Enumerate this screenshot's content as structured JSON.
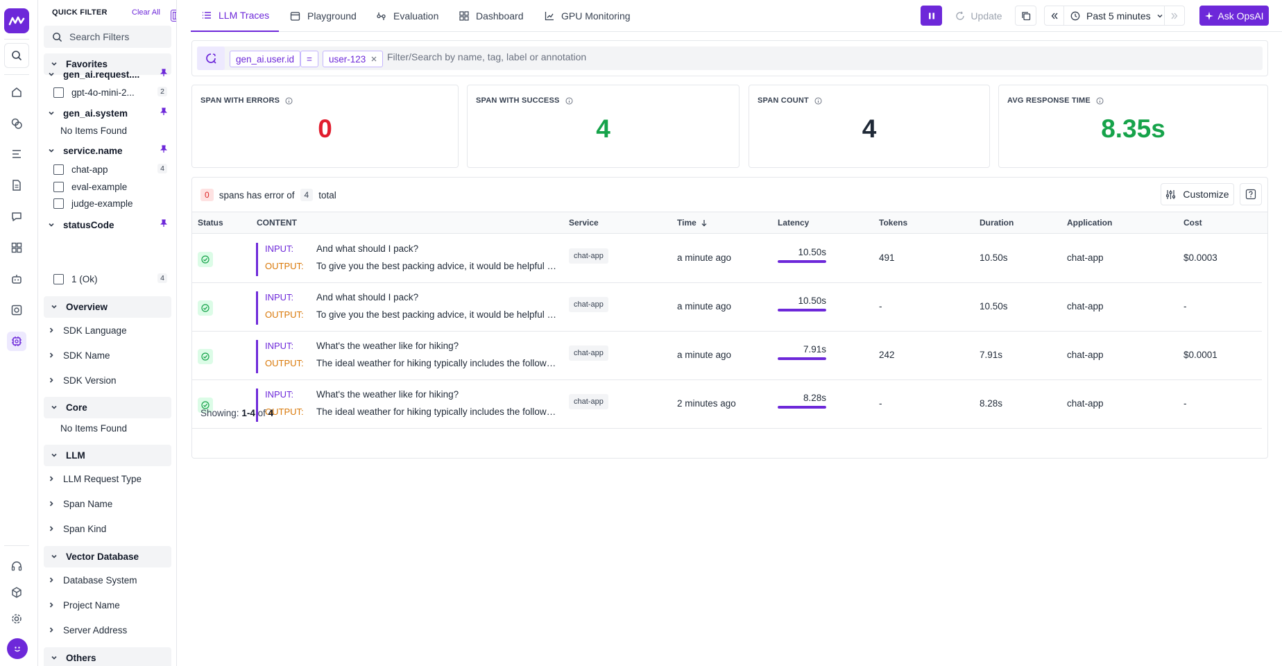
{
  "sidebar": {
    "title": "QUICK FILTER",
    "clear_all": "Clear All",
    "search_placeholder": "Search Filters",
    "favorites": "Favorites",
    "fav_groups": [
      {
        "label": "gen_ai.request....",
        "items": [
          {
            "label": "gpt-4o-mini-2...",
            "count": "2"
          }
        ]
      },
      {
        "label": "gen_ai.system",
        "empty": "No Items Found"
      },
      {
        "label": "service.name",
        "items": [
          {
            "label": "chat-app",
            "count": "4"
          },
          {
            "label": "eval-example"
          },
          {
            "label": "judge-example"
          }
        ]
      },
      {
        "label": "statusCode",
        "items": [
          {
            "label": "1 (Ok)",
            "count": "4"
          }
        ]
      }
    ],
    "overview": {
      "label": "Overview",
      "items": [
        "SDK Language",
        "SDK Name",
        "SDK Version"
      ]
    },
    "core": {
      "label": "Core",
      "empty": "No Items Found"
    },
    "llm": {
      "label": "LLM",
      "items": [
        "LLM Request Type",
        "Span Name",
        "Span Kind"
      ]
    },
    "vector": {
      "label": "Vector Database",
      "items": [
        "Database System",
        "Project Name",
        "Server Address"
      ]
    },
    "others": {
      "label": "Others"
    }
  },
  "nav": {
    "tabs": [
      "LLM Traces",
      "Playground",
      "Evaluation",
      "Dashboard",
      "GPU Monitoring"
    ],
    "update": "Update",
    "time_range": "Past 5 minutes",
    "ask": "Ask OpsAI"
  },
  "search": {
    "chip_key": "gen_ai.user.id",
    "chip_op": "=",
    "chip_value": "user-123",
    "placeholder": "Filter/Search by name, tag, label or annotation"
  },
  "stats": [
    {
      "label": "SPAN WITH ERRORS",
      "value": "0",
      "color": "#e11d2e"
    },
    {
      "label": "SPAN WITH SUCCESS",
      "value": "4",
      "color": "#16a34a"
    },
    {
      "label": "SPAN COUNT",
      "value": "4",
      "color": "#1f2937"
    },
    {
      "label": "AVG RESPONSE TIME",
      "value": "8.35s",
      "color": "#16a34a"
    }
  ],
  "table": {
    "summary": {
      "errors": "0",
      "middle": "spans has error of",
      "total": "4",
      "suffix": "total"
    },
    "customize": "Customize",
    "columns": [
      "Status",
      "CONTENT",
      "Service",
      "Time",
      "Latency",
      "Tokens",
      "Duration",
      "Application",
      "Cost"
    ],
    "input_label": "INPUT:",
    "output_label": "OUTPUT:",
    "rows": [
      {
        "input": "And what should I pack?",
        "output": "To give you the best packing advice, it would be helpful to know more about your trip.",
        "service": "chat-app",
        "time": "a minute ago",
        "latency": "10.50s",
        "latency_fraction": 1.0,
        "tokens": "491",
        "duration": "10.50s",
        "application": "chat-app",
        "cost": "$0.0003"
      },
      {
        "input": "And what should I pack?",
        "output": "To give you the best packing advice, it would be helpful to know more about your trip.",
        "service": "chat-app",
        "time": "a minute ago",
        "latency": "10.50s",
        "latency_fraction": 1.0,
        "tokens": "-",
        "duration": "10.50s",
        "application": "chat-app",
        "cost": "-"
      },
      {
        "input": "What's the weather like for hiking?",
        "output": "The ideal weather for hiking typically includes the following conditions.",
        "service": "chat-app",
        "time": "a minute ago",
        "latency": "7.91s",
        "latency_fraction": 1.0,
        "tokens": "242",
        "duration": "7.91s",
        "application": "chat-app",
        "cost": "$0.0001"
      },
      {
        "input": "What's the weather like for hiking?",
        "output": "The ideal weather for hiking typically includes the following conditions.",
        "service": "chat-app",
        "time": "2 minutes ago",
        "latency": "8.28s",
        "latency_fraction": 1.0,
        "tokens": "-",
        "duration": "8.28s",
        "application": "chat-app",
        "cost": "-"
      }
    ],
    "showing": {
      "prefix": "Showing:",
      "range": "1-4",
      "of": "of",
      "total": "4"
    }
  }
}
